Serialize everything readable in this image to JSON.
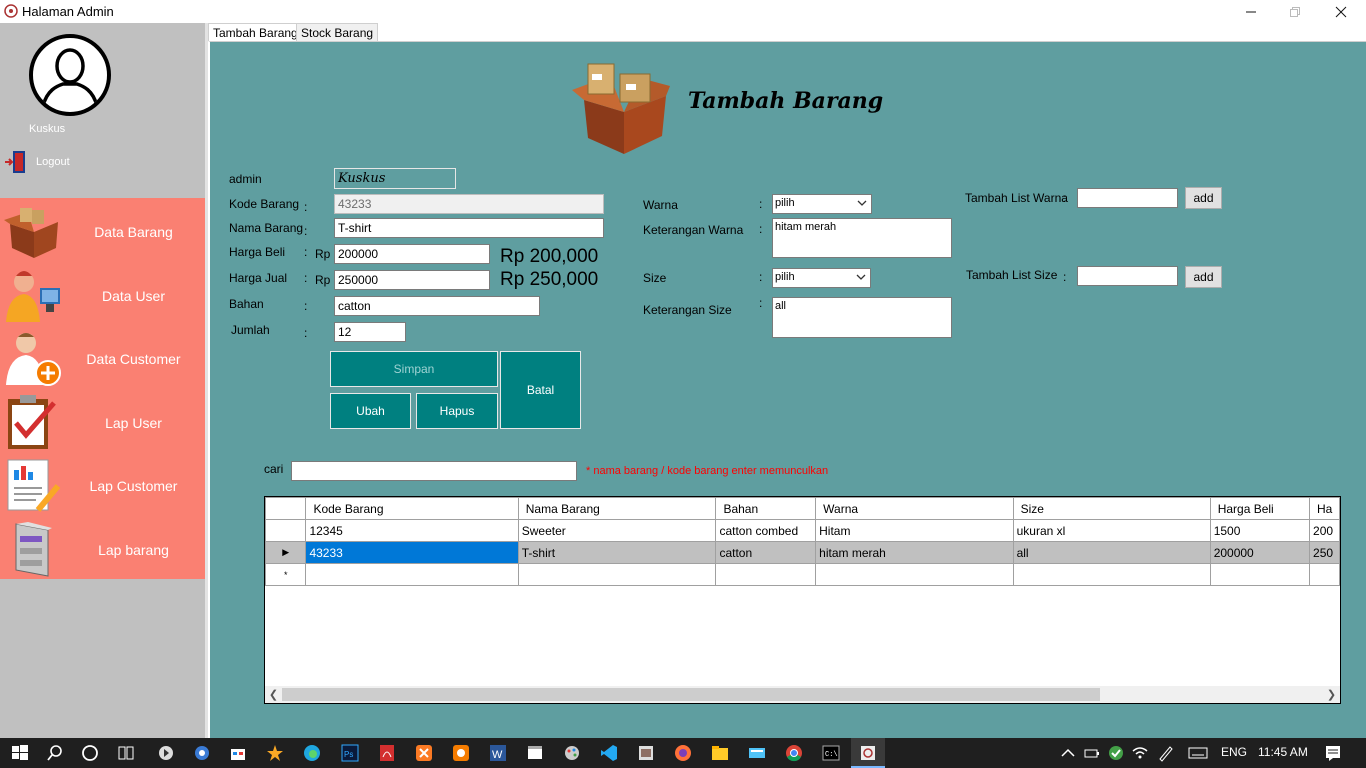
{
  "window": {
    "title": "Halaman Admin"
  },
  "sidebar": {
    "username": "Kuskus",
    "logout": "Logout",
    "items": [
      {
        "label": "Data Barang"
      },
      {
        "label": "Data User"
      },
      {
        "label": "Data Customer"
      },
      {
        "label": "Lap User"
      },
      {
        "label": "Lap Customer"
      },
      {
        "label": "Lap barang"
      }
    ]
  },
  "tabs": [
    {
      "label": "Tambah Barang"
    },
    {
      "label": "Stock Barang"
    }
  ],
  "form": {
    "heading": "Tambah Barang",
    "admin_label": "admin",
    "admin_value": "Kuskus",
    "kode_label": "Kode Barang",
    "kode_value": "43233",
    "nama_label": "Nama Barang",
    "nama_value": "T-shirt",
    "beli_label": "Harga Beli",
    "beli_prefix": "Rp",
    "beli_value": "200000",
    "beli_display": "Rp 200,000",
    "jual_label": "Harga Jual",
    "jual_prefix": "Rp",
    "jual_value": "250000",
    "jual_display": "Rp 250,000",
    "bahan_label": "Bahan",
    "bahan_value": "catton",
    "jumlah_label": "Jumlah",
    "jumlah_value": "12",
    "colon": ":",
    "warna_label": "Warna",
    "warna_select": "pilih",
    "ket_warna_label": "Keterangan Warna",
    "ket_warna_value": "hitam merah",
    "size_label": "Size",
    "size_select": "pilih",
    "ket_size_label": "Keterangan Size",
    "ket_size_value": "all",
    "tambah_warna_label": "Tambah List Warna",
    "tambah_warna_value": "",
    "tambah_size_label": "Tambah List Size",
    "tambah_size_value": "",
    "add_label": "add"
  },
  "buttons": {
    "simpan": "Simpan",
    "ubah": "Ubah",
    "hapus": "Hapus",
    "batal": "Batal"
  },
  "search": {
    "label": "cari",
    "value": "",
    "hint": "* nama barang / kode barang enter memunculkan"
  },
  "table": {
    "columns": [
      "Kode Barang",
      "Nama Barang",
      "Bahan",
      "Warna",
      "Size",
      "Harga Beli",
      "Ha"
    ],
    "rows": [
      [
        "12345",
        "Sweeter",
        "catton combed",
        "Hitam",
        "ukuran xl",
        "1500",
        "200"
      ],
      [
        "43233",
        "T-shirt",
        "catton",
        "hitam merah",
        "all",
        "200000",
        "250"
      ]
    ],
    "new_row_marker": "*",
    "current_row_marker": "▶"
  },
  "taskbar": {
    "language": "ENG",
    "time": "11:45 AM"
  }
}
